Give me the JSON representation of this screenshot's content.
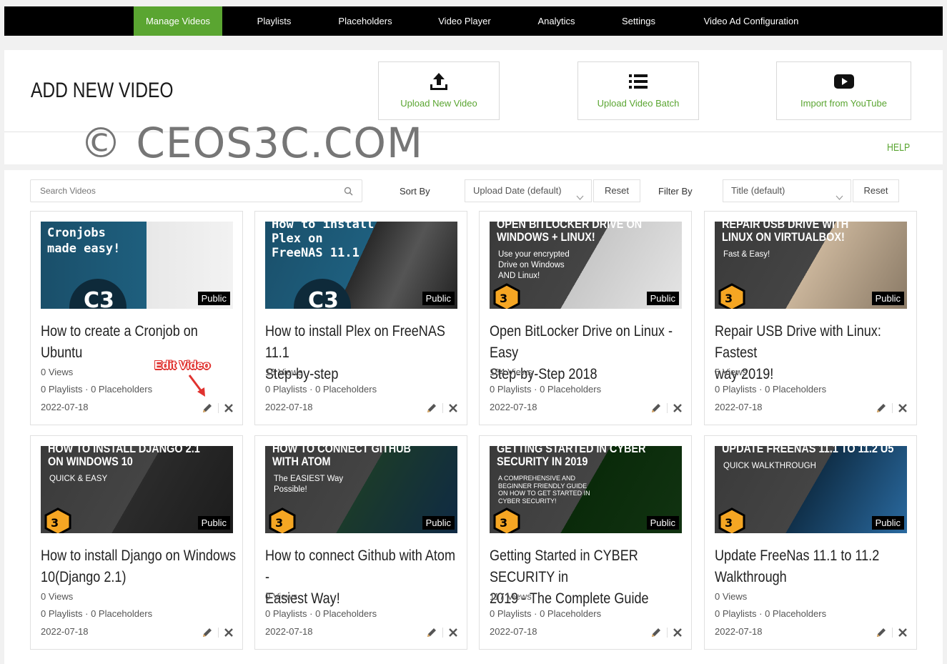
{
  "nav": {
    "tabs": [
      {
        "label": "Manage Videos",
        "active": true
      },
      {
        "label": "Playlists"
      },
      {
        "label": "Placeholders"
      },
      {
        "label": "Video Player"
      },
      {
        "label": "Analytics"
      },
      {
        "label": "Settings"
      },
      {
        "label": "Video Ad Configuration"
      }
    ]
  },
  "header": {
    "title": "ADD NEW VIDEO",
    "actions": [
      {
        "label": "Upload New Video",
        "icon": "upload-icon"
      },
      {
        "label": "Upload Video Batch",
        "icon": "list-icon"
      },
      {
        "label": "Import from YouTube",
        "icon": "youtube-icon"
      }
    ],
    "watermark": "© CEOS3C.COM",
    "help": "HELP"
  },
  "toolbar": {
    "search_placeholder": "Search Videos",
    "sort_label": "Sort By",
    "sort_value": "Upload Date (default)",
    "reset1": "Reset",
    "filter_label": "Filter By",
    "filter_value": "Title (default)",
    "reset2": "Reset"
  },
  "annotation": "Edit Video",
  "colors": {
    "accent": "#5aa531",
    "nav_bg": "#000000"
  },
  "videos": [
    {
      "title_l1": "How to create a Cronjob on Ubuntu",
      "title_l2": "",
      "views": "0 Views",
      "counts": "0 Playlists · 0 Placeholders",
      "date": "2022-07-18",
      "badge": "Public",
      "thumb": {
        "lines": [
          "Cronjobs",
          "made easy!"
        ]
      }
    },
    {
      "title_l1": "How to install Plex on FreeNAS 11.1",
      "title_l2": "Step-by-step",
      "views": "18 Views",
      "counts": "0 Playlists · 0 Placeholders",
      "date": "2022-07-18",
      "badge": "Public",
      "thumb": {
        "lines": [
          "How to install",
          "Plex on",
          "FreeNAS 11.1"
        ]
      }
    },
    {
      "title_l1": "Open BitLocker Drive on Linux - Easy",
      "title_l2": "Step-by-Step 2018",
      "views": "184 Views",
      "counts": "0 Playlists · 0 Placeholders",
      "date": "2022-07-18",
      "badge": "Public",
      "thumb": {
        "lines": [
          "OPEN BITLOCKER DRIVE ON",
          "WINDOWS + LINUX!"
        ],
        "sub": [
          "Use your encrypted",
          "Drive on Windows",
          "AND Linux!"
        ]
      }
    },
    {
      "title_l1": "Repair USB Drive with Linux: Fastest",
      "title_l2": "way 2019!",
      "views": "5 Views",
      "counts": "0 Playlists · 0 Placeholders",
      "date": "2022-07-18",
      "badge": "Public",
      "thumb": {
        "lines": [
          "REPAIR USB DRIVE WITH",
          "LINUX ON VIRTUALBOX!"
        ],
        "sub": [
          "Fast & Easy!"
        ]
      }
    },
    {
      "title_l1": "How to install Django on Windows",
      "title_l2": "10(Django 2.1)",
      "views": "0 Views",
      "counts": "0 Playlists · 0 Placeholders",
      "date": "2022-07-18",
      "badge": "Public",
      "thumb": {
        "lines": [
          "HOW TO INSTALL DJANGO 2.1",
          "ON WINDOWS 10"
        ],
        "sub": [
          "QUICK & EASY"
        ]
      }
    },
    {
      "title_l1": "How to connect Github with Atom -",
      "title_l2": "Easiest Way!",
      "views": "0 Views",
      "counts": "0 Playlists · 0 Placeholders",
      "date": "2022-07-18",
      "badge": "Public",
      "thumb": {
        "lines": [
          "HOW TO CONNECT GITHUB",
          "WITH ATOM"
        ],
        "sub": [
          "The EASIEST Way",
          "Possible!"
        ]
      }
    },
    {
      "title_l1": "Getting Started in CYBER SECURITY in",
      "title_l2": "2019 - The Complete Guide",
      "views": "117 Views",
      "counts": "0 Playlists · 0 Placeholders",
      "date": "2022-07-18",
      "badge": "Public",
      "thumb": {
        "lines": [
          "GETTING STARTED IN CYBER",
          "SECURITY IN 2019"
        ],
        "sub": [
          "A COMPREHENSIVE AND",
          "BEGINNER FRIENDLY GUIDE",
          "ON HOW TO GET STARTED IN",
          "CYBER SECURITY!"
        ]
      }
    },
    {
      "title_l1": "Update FreeNas 11.1 to 11.2",
      "title_l2": "Walkthrough",
      "views": "0 Views",
      "counts": "0 Playlists · 0 Placeholders",
      "date": "2022-07-18",
      "badge": "Public",
      "thumb": {
        "lines": [
          "UPDATE FREENAS 11.1 TO 11.2 U5"
        ],
        "sub": [
          "QUICK WALKTHROUGH"
        ]
      }
    }
  ]
}
